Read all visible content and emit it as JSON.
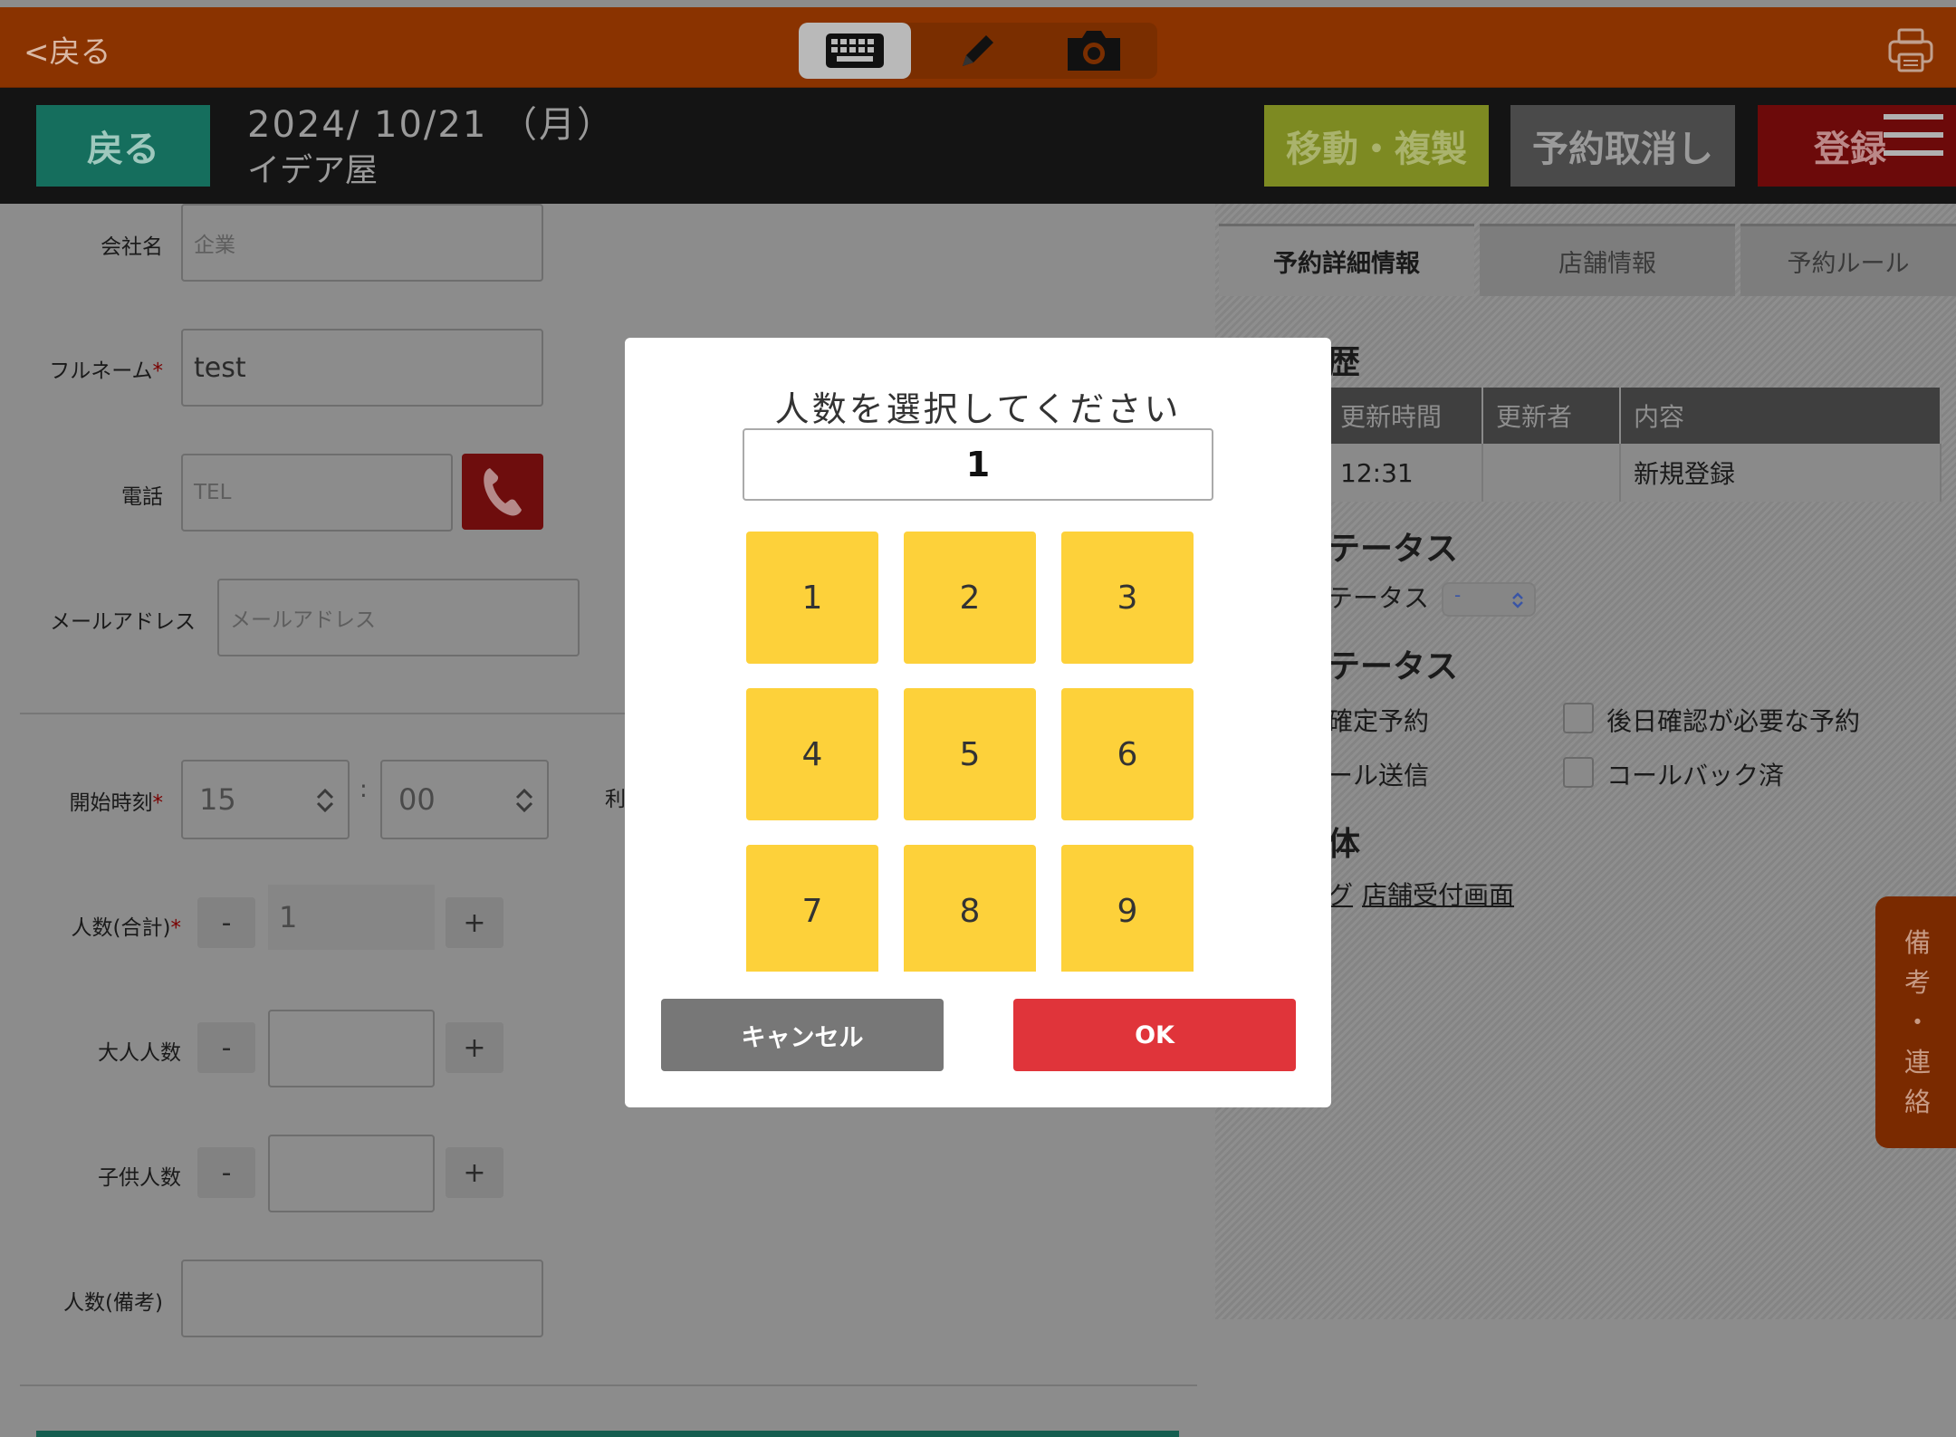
{
  "topbar": {
    "back_link": "<戻る",
    "tools": [
      "keyboard-icon",
      "pencil-icon",
      "camera-icon"
    ],
    "print_icon": "printer-icon"
  },
  "header": {
    "back_button": "戻る",
    "date": "2024/ 10/21 （月）",
    "shop_name": "イデア屋",
    "move_copy_button": "移動・複製",
    "cancel_reservation_button": "予約取消し",
    "register_button": "登録",
    "menu_icon": "hamburger-menu-icon"
  },
  "form": {
    "company": {
      "label": "会社名",
      "placeholder": "企業",
      "value": ""
    },
    "fullname": {
      "label": "フルネーム",
      "required_mark": "*",
      "value": "test"
    },
    "phone": {
      "label": "電話",
      "placeholder": "TEL",
      "value": ""
    },
    "email": {
      "label": "メールアドレス",
      "placeholder": "メールアドレス",
      "value": ""
    },
    "start_time": {
      "label": "開始時刻",
      "required_mark": "*",
      "hour": "15",
      "separator": ":",
      "minute": "00"
    },
    "cut_label": "利",
    "total_people": {
      "label": "人数(合計)",
      "required_mark": "*",
      "minus": "-",
      "value": "1",
      "plus": "+"
    },
    "adults": {
      "label": "大人人数",
      "minus": "-",
      "value": "",
      "plus": "+"
    },
    "children": {
      "label": "子供人数",
      "minus": "-",
      "value": "",
      "plus": "+"
    },
    "people_note": {
      "label": "人数(備考)",
      "value": ""
    }
  },
  "right_panel": {
    "tabs": [
      {
        "label": "予約詳細情報",
        "active": true
      },
      {
        "label": "店舗情報",
        "active": false
      },
      {
        "label": "予約ルール",
        "active": false
      }
    ],
    "history": {
      "title": "歴",
      "columns": [
        "更新時間",
        "更新者",
        "内容"
      ],
      "rows": [
        [
          "12:31",
          "",
          "新規登録"
        ]
      ]
    },
    "status_section": {
      "title": "テータス",
      "label": "テータス",
      "select_value": "-"
    },
    "status2_section": {
      "title": "テータス",
      "items": [
        {
          "label": "確定予約"
        },
        {
          "label": "ール送信"
        },
        {
          "label": "後日確認が必要な予約"
        },
        {
          "label": "コールバック済"
        }
      ]
    },
    "media_section": {
      "title": "体",
      "link_prefix": "グ",
      "link": "店舗受付画面"
    }
  },
  "side_tab": {
    "chars": [
      "備",
      "考",
      "・",
      "連",
      "絡"
    ]
  },
  "modal": {
    "title": "人数を選択してください",
    "display_value": "1",
    "keys": [
      "1",
      "2",
      "3",
      "4",
      "5",
      "6",
      "7",
      "8",
      "9"
    ],
    "cancel_button": "キャンセル",
    "ok_button": "OK"
  },
  "colors": {
    "topbar": "#8a3300",
    "keypad_key": "#fdd13a",
    "ok_button": "#e0343a",
    "cancel_button": "#777777",
    "back_button": "#156e5d"
  }
}
